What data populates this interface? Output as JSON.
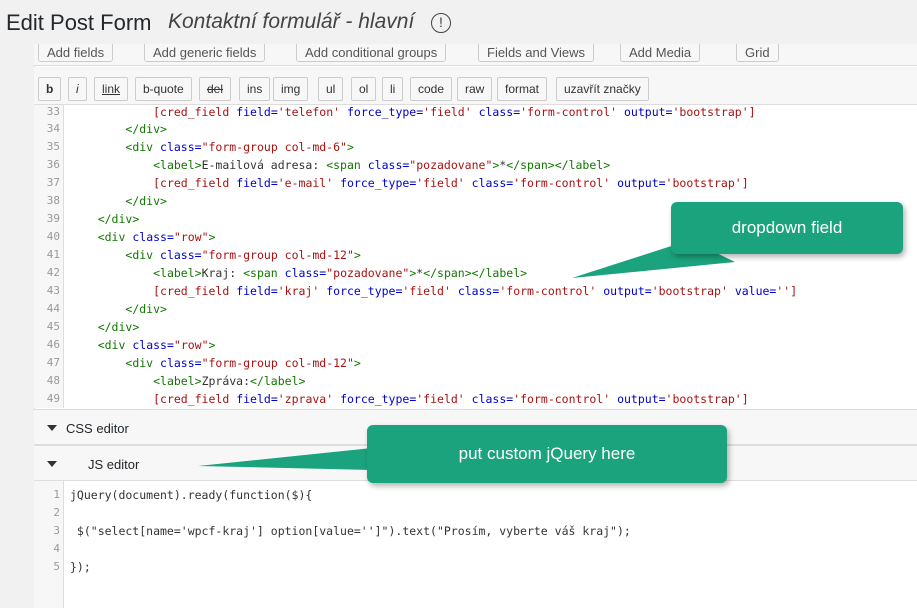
{
  "header": {
    "title": "Edit Post Form",
    "subtitle": "Kontaktní formulář - hlavní",
    "info_icon": "info-circle-icon"
  },
  "top_buttons": [
    {
      "label": "Add fields"
    },
    {
      "label": "Add generic fields"
    },
    {
      "label": "Add conditional groups"
    },
    {
      "label": "Fields and Views"
    },
    {
      "label": "Add Media"
    },
    {
      "label": "Grid"
    }
  ],
  "toolbar": {
    "buttons": [
      "b",
      "i",
      "link",
      "b-quote",
      "del",
      "ins",
      "img",
      "ul",
      "ol",
      "li",
      "code",
      "raw",
      "format",
      "uzavřít značky"
    ]
  },
  "html_editor": {
    "line_numbers": [
      "33",
      "34",
      "35",
      "36",
      "37",
      "38",
      "39",
      "40",
      "41",
      "42",
      "43",
      "44",
      "45",
      "46",
      "47",
      "48",
      "49"
    ]
  },
  "css_editor": {
    "label": "CSS editor"
  },
  "js_editor": {
    "label": "JS editor",
    "line_numbers": [
      "1",
      "2",
      "3",
      "4",
      "5"
    ],
    "lines": [
      "jQuery(document).ready(function($){",
      "",
      " $(\"select[name='wpcf-kraj'] option[value='']\").text(\"Prosím, vyberte váš kraj\");",
      "",
      "});"
    ]
  },
  "callouts": {
    "dropdown": "dropdown field",
    "jquery": "put custom jQuery here"
  },
  "colors": {
    "callout_green": "#1aa37c",
    "tag_green": "#117700",
    "attr_blue": "#0000cc",
    "string_red": "#aa1111"
  }
}
